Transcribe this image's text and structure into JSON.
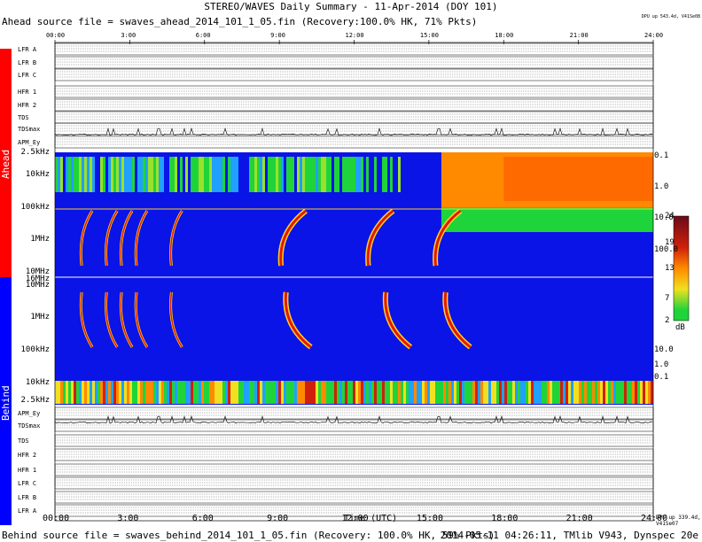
{
  "header": {
    "title": "STEREO/WAVES Daily Summary - 11-Apr-2014 (DOY 101)",
    "ahead_source": "Ahead source file = swaves_ahead_2014_101_1_05.fin (Recovery:100.0% HK, 71% Pkts)",
    "ahead_dpu": "DPU up 543.4d, V41Se08"
  },
  "footer": {
    "behind_source": "Behind source file = swaves_behind_2014_101_1_05.fin (Recovery: 100.0% HK, 59% Pkts)",
    "stamp": "2014-05-11 04:26:11, TMlib V943, Dynspec 20e",
    "behind_dpu": "DPU up 339.4d, V41Se07",
    "xlabel": "Time (UTC)"
  },
  "side": {
    "ahead": "Ahead",
    "behind": "Behind",
    "ahead_color": "#ff0000",
    "behind_color": "#0000ff"
  },
  "time_ticks": [
    "00:00",
    "3:00",
    "6:00",
    "9:00",
    "12:00",
    "15:00",
    "18:00",
    "21:00",
    "24:00"
  ],
  "ahead_channels": [
    "LFR A",
    "LFR B",
    "LFR C",
    "HFR 1",
    "HFR 2",
    "TDS",
    "TDSmax",
    "APM_Ey"
  ],
  "behind_channels": [
    "APM_Ey",
    "TDSmax",
    "TDS",
    "HFR 2",
    "HFR 1",
    "LFR C",
    "LFR B",
    "LFR A"
  ],
  "freq_labels_ahead": [
    "2.5kHz",
    "10kHz",
    "100kHz",
    "1MHz",
    "10MHz",
    "16MHz"
  ],
  "freq_labels_behind": [
    "10MHz",
    "1MHz",
    "100kHz",
    "10kHz",
    "2.5kHz"
  ],
  "right_labels_ahead": [
    "0.1",
    "1.0",
    "10.0",
    "100.0"
  ],
  "right_labels_behind": [
    "1.0",
    "10.0",
    "100.0",
    "10.0",
    "1.0",
    "0.1"
  ],
  "colorbar": {
    "ticks": [
      "24",
      "19",
      "13",
      "7",
      "2"
    ],
    "unit": "dB"
  },
  "chart_data": {
    "type": "heatmap",
    "title": "STEREO/WAVES Daily Summary - 11-Apr-2014 (DOY 101)",
    "xlabel": "Time (UTC)",
    "ylabel": "",
    "x_range_hours": [
      0,
      24
    ],
    "y_axis": "frequency, log scale, 2.5kHz to 16MHz",
    "color_range_db": [
      2,
      24
    ],
    "panels": [
      "Ahead",
      "Behind"
    ],
    "type_iii_bursts_ahead_hours": [
      1.0,
      2.0,
      2.6,
      3.2,
      4.6,
      9.0,
      12.5,
      15.2
    ],
    "type_iii_bursts_behind_hours": [
      1.0,
      2.0,
      2.6,
      3.2,
      4.6,
      9.2,
      13.2,
      15.6
    ],
    "ahead_high_intensity_after_hours": 15.5
  }
}
